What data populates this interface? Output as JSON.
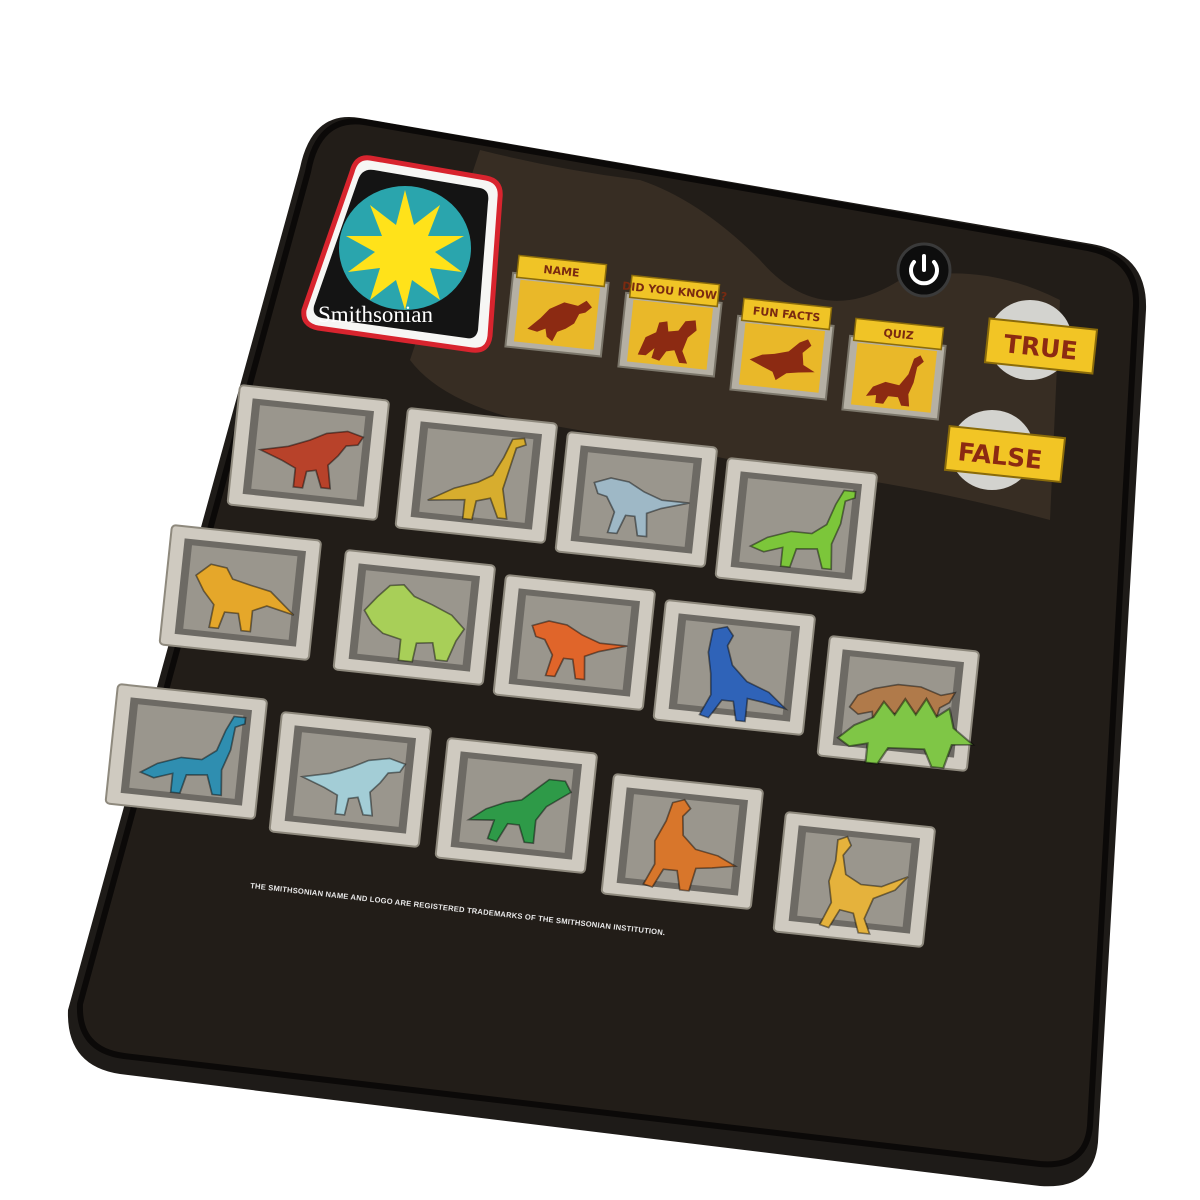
{
  "logo": {
    "text": "Smithsonian"
  },
  "modes": [
    {
      "id": "name",
      "label": "NAME",
      "icon": "t-rex-silhouette-icon"
    },
    {
      "id": "did_you_know",
      "label": "DID YOU KNOW ?",
      "icon": "dino-group-silhouette-icon"
    },
    {
      "id": "fun_facts",
      "label": "FUN FACTS",
      "icon": "plesiosaur-silhouette-icon"
    },
    {
      "id": "quiz",
      "label": "QUIZ",
      "icon": "sauropod-silhouette-icon"
    }
  ],
  "answers": {
    "true_label": "TRUE",
    "false_label": "FALSE"
  },
  "power": {
    "icon": "power-icon"
  },
  "dinosaurs": [
    {
      "row": 1,
      "col": 1,
      "color": "#b8422a",
      "kind": "theropod"
    },
    {
      "row": 1,
      "col": 2,
      "color": "#d7ad2e",
      "kind": "longneck"
    },
    {
      "row": 1,
      "col": 3,
      "color": "#9eb8c6",
      "kind": "raptor"
    },
    {
      "row": 1,
      "col": 4,
      "color": "#7cc63a",
      "kind": "sauropod"
    },
    {
      "row": 2,
      "col": 1,
      "color": "#e5a72a",
      "kind": "ceratopsian"
    },
    {
      "row": 2,
      "col": 2,
      "color": "#a8cf58",
      "kind": "triceratops"
    },
    {
      "row": 2,
      "col": 3,
      "color": "#e0652a",
      "kind": "raptor"
    },
    {
      "row": 2,
      "col": 4,
      "color": "#2f63b8",
      "kind": "oviraptor"
    },
    {
      "row": 2,
      "col": 5,
      "color": "#b07a4a",
      "kind": "ankylosaur"
    },
    {
      "row": 3,
      "col": 1,
      "color": "#2f8eb0",
      "kind": "sauropod"
    },
    {
      "row": 3,
      "col": 2,
      "color": "#a3cdd6",
      "kind": "theropod"
    },
    {
      "row": 3,
      "col": 3,
      "color": "#2e9a48",
      "kind": "pachycephalosaur"
    },
    {
      "row": 3,
      "col": 4,
      "color": "#d8762b",
      "kind": "dilophosaur"
    },
    {
      "row": 3,
      "col": 5,
      "color": "#e5b23c",
      "kind": "ornithomimid"
    },
    {
      "row": 2,
      "col": 6,
      "color": "#7fc646",
      "kind": "stegosaur"
    }
  ],
  "footer": "THE SMITHSONIAN NAME AND LOGO ARE REGISTERED TRADEMARKS OF THE SMITHSONIAN INSTITUTION."
}
